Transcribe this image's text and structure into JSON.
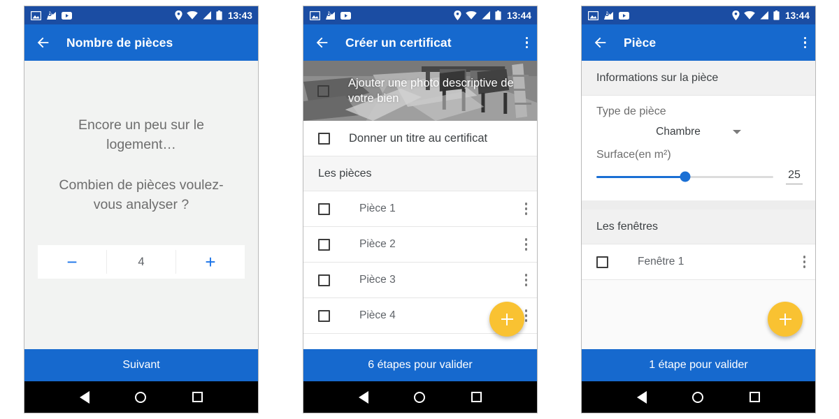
{
  "statusbar": {
    "left_icons": [
      "image-icon",
      "maps-icon",
      "youtube-icon"
    ],
    "right_icons": [
      "location-icon",
      "wifi-icon",
      "signal-icon",
      "battery-icon"
    ],
    "time_1": "13:43",
    "time_2": "13:44",
    "time_3": "13:44"
  },
  "colors": {
    "status_bar": "#1b4da3",
    "app_bar": "#1669ce",
    "accent_blue": "#1a73e8",
    "fab_yellow": "#f9c232",
    "body_gray": "#f2f3f2",
    "text_gray": "#6d6d6d"
  },
  "navbar": {
    "back_label": "back",
    "home_label": "home",
    "recents_label": "recents"
  },
  "screen1": {
    "title": "Nombre de pièces",
    "back_icon": "back-arrow-icon",
    "prompt_line1": "Encore un peu sur le logement…",
    "prompt_line2": "Combien de pièces voulez-vous analyser ?",
    "stepper": {
      "minus_label": "−",
      "value": "4",
      "plus_label": "+"
    },
    "bottom_button": "Suivant"
  },
  "screen2": {
    "title": "Créer un certificat",
    "back_icon": "back-arrow-icon",
    "overflow_icon": "overflow-menu-icon",
    "hero": {
      "checkbox_name": "add-photo-checkbox",
      "text": "Ajouter une photo descriptive de votre bien"
    },
    "title_row": {
      "checkbox_name": "certificate-title-checkbox",
      "label": "Donner un titre au certificat"
    },
    "section_header": "Les pièces",
    "rooms": [
      {
        "label": "Pièce 1"
      },
      {
        "label": "Pièce 2"
      },
      {
        "label": "Pièce 3"
      },
      {
        "label": "Pièce 4"
      }
    ],
    "fab_label": "+",
    "bottom_button": "6 étapes pour valider"
  },
  "screen3": {
    "title": "Pièce",
    "back_icon": "back-arrow-icon",
    "overflow_icon": "overflow-menu-icon",
    "section_info": "Informations sur la pièce",
    "type_label": "Type de pièce",
    "type_value": "Chambre",
    "surface_label": "Surface(en m²)",
    "surface_value": "25",
    "surface_percent": 50,
    "section_windows": "Les fenêtres",
    "windows": [
      {
        "label": "Fenêtre 1"
      }
    ],
    "fab_label": "+",
    "bottom_button": "1 étape pour valider"
  }
}
